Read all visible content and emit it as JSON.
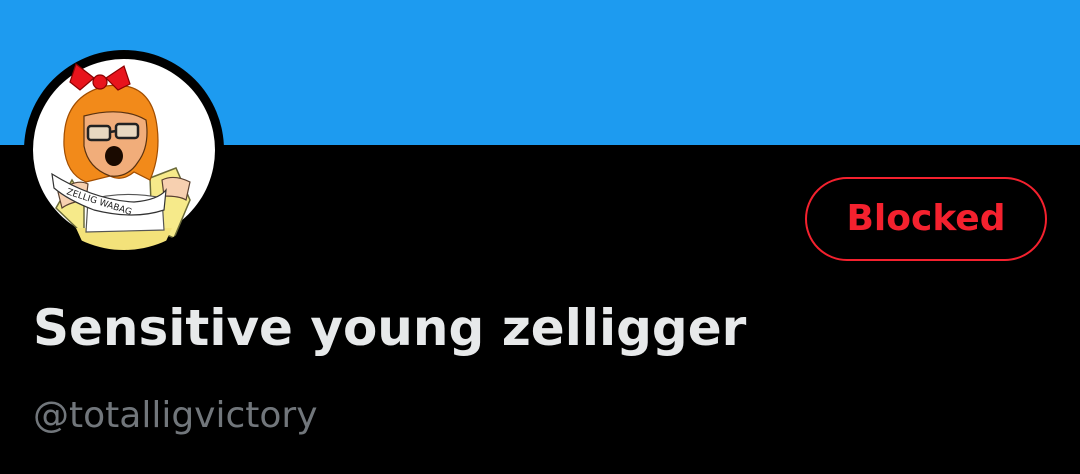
{
  "profile": {
    "display_name": "Sensitive young zelligger",
    "handle": "@totalligvictory",
    "block_button_label": "Blocked",
    "avatar_sign_text": "ZELLIG WABAG",
    "avatar_icon": "cartoon-avatar-image"
  },
  "colors": {
    "banner": "#1d9bf0",
    "background": "#000000",
    "blocked_red": "#f4212e",
    "name_text": "#e7e9ea",
    "handle_text": "#71767b"
  }
}
